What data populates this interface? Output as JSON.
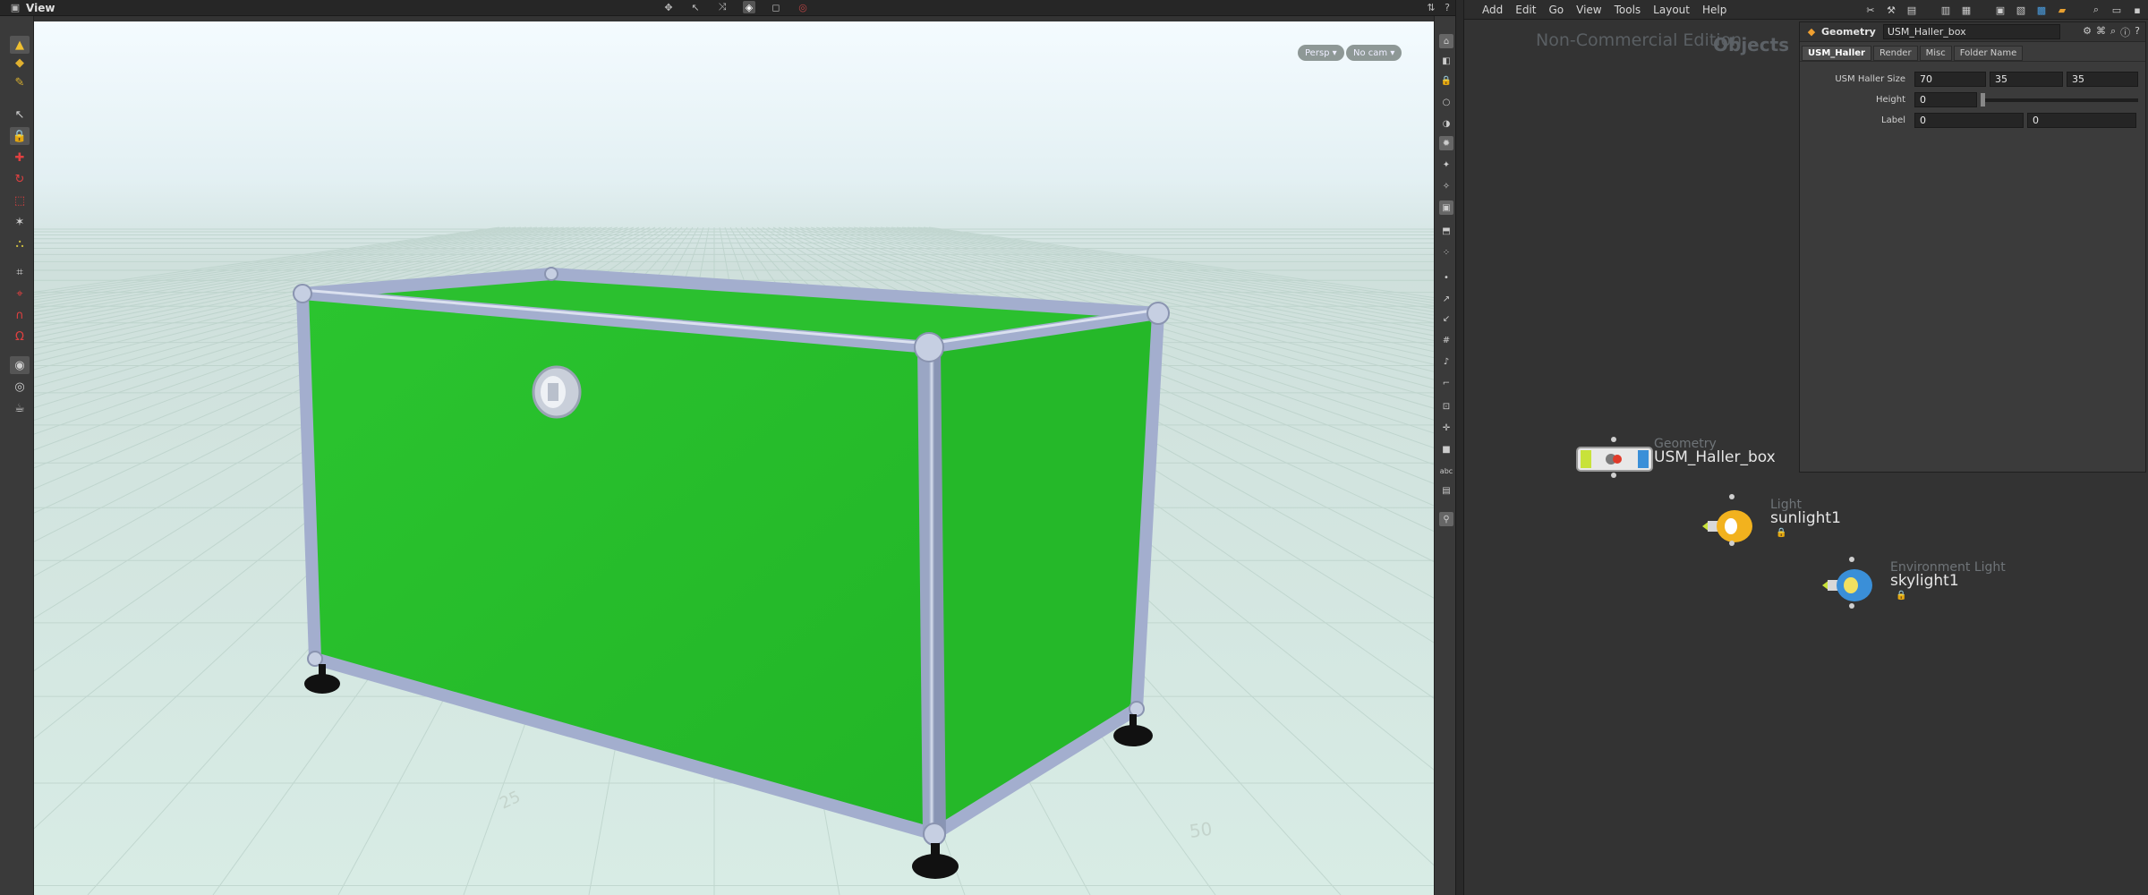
{
  "viewport": {
    "title": "View",
    "cam_persp": "Persp",
    "cam_nocam": "No cam",
    "grid_labels": [
      "50",
      "25"
    ]
  },
  "network": {
    "menu": [
      "Add",
      "Edit",
      "Go",
      "View",
      "Tools",
      "Layout",
      "Help"
    ],
    "watermark": "Non-Commercial Edition",
    "context": "Objects",
    "nodes": [
      {
        "type": "Geometry",
        "name": "USM_Haller_box"
      },
      {
        "type": "Light",
        "name": "sunlight1"
      },
      {
        "type": "Environment Light",
        "name": "skylight1"
      }
    ]
  },
  "params": {
    "node_type": "Geometry",
    "node_name": "USM_Haller_box",
    "tabs": [
      "USM_Haller",
      "Render",
      "Misc",
      "Folder Name"
    ],
    "size_label": "USM Haller Size",
    "size_values": [
      "70",
      "35",
      "35"
    ],
    "height_label": "Height",
    "height_value": "0",
    "height_fraction": 0.0,
    "label_label": "Label",
    "label_values": [
      "0",
      "0"
    ]
  },
  "colors": {
    "panel_green": "#27bb2b",
    "accent_blue": "#3a8fd8",
    "light_yellow": "#f2b21e"
  }
}
